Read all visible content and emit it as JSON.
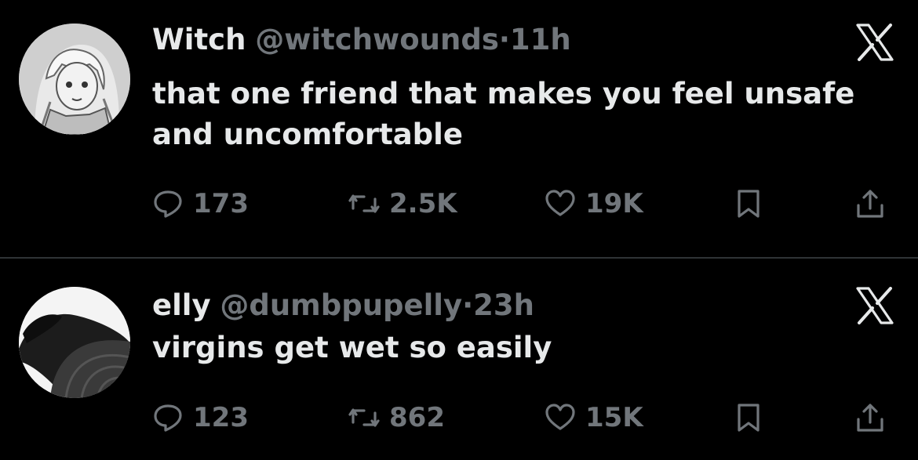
{
  "tweets": [
    {
      "name": "Witch",
      "handle": "@witchwounds",
      "separator": "·",
      "time": "11h",
      "text": "that one friend that makes you feel unsafe and uncomfortable",
      "replies": "173",
      "retweets": "2.5K",
      "likes": "19K"
    },
    {
      "name": "elly",
      "handle": "@dumbpupelly",
      "separator": "·",
      "time": "23h",
      "text": "virgins get wet so easily",
      "replies": "123",
      "retweets": "862",
      "likes": "15K"
    }
  ],
  "icons": {
    "reply": "reply-icon",
    "retweet": "retweet-icon",
    "like": "heart-icon",
    "bookmark": "bookmark-icon",
    "share": "share-icon",
    "brand": "x-logo-icon"
  },
  "colors": {
    "background": "#000000",
    "text": "#e7e9ea",
    "muted": "#71767b",
    "divider": "#2f3336"
  }
}
